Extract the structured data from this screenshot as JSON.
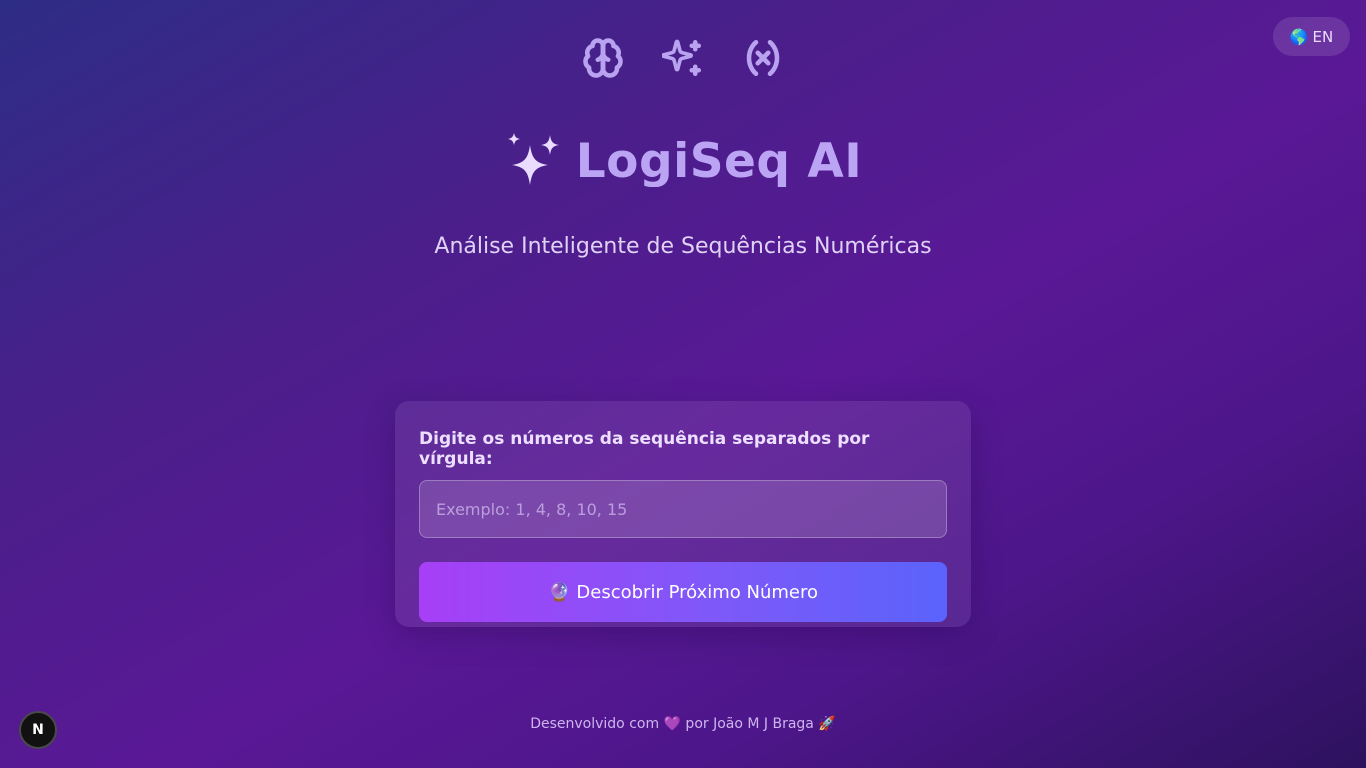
{
  "header": {
    "icons": [
      "brain-icon",
      "sparkles-icon",
      "variable-icon"
    ],
    "lang_button": {
      "flag": "🌎",
      "label": "EN"
    }
  },
  "hero": {
    "emoji": "sparkles-icon",
    "title": "LogiSeq AI",
    "subtitle": "Análise Inteligente de Sequências Numéricas"
  },
  "form": {
    "label": "Digite os números da sequência separados por vírgula:",
    "input_value": "",
    "input_placeholder": "Exemplo: 1, 4, 8, 10, 15",
    "button_emoji": "🔮",
    "button_label": "Descobrir Próximo Número"
  },
  "footer": {
    "text": "Desenvolvido com 💜 por João M J Braga  🚀"
  },
  "dev_badge": {
    "letter": "N"
  },
  "colors": {
    "accent_title": "#bca4f4",
    "button_start": "#a73ff6",
    "button_end": "#5a63fb"
  }
}
